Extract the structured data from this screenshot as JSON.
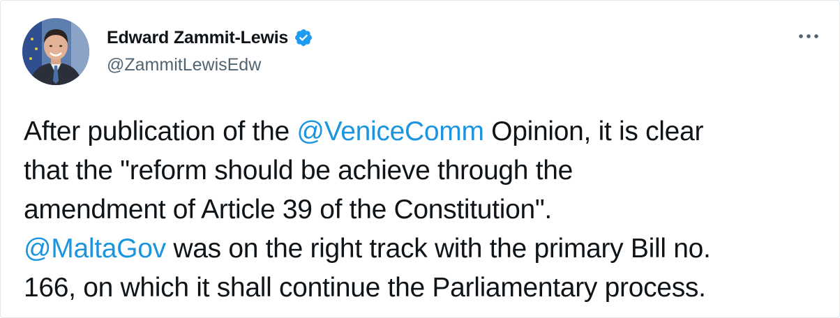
{
  "author": {
    "display_name": "Edward Zammit-Lewis",
    "handle": "@ZammitLewisEdw",
    "verified": true,
    "avatar_icon": "profile-photo",
    "verified_icon": "verified-badge-icon"
  },
  "menu": {
    "icon": "more-options-icon"
  },
  "tweet": {
    "lines": [
      [
        {
          "text": "After publication of the ",
          "type": "text"
        },
        {
          "text": "@VeniceComm",
          "type": "mention"
        },
        {
          "text": " Opinion, it is clear",
          "type": "text"
        }
      ],
      [
        {
          "text": "that the \"reform should be achieve through the",
          "type": "text"
        }
      ],
      [
        {
          "text": "amendment of Article 39 of the Constitution\".",
          "type": "text"
        }
      ],
      [
        {
          "text": "@MaltaGov",
          "type": "mention"
        },
        {
          "text": " was on the right track with the primary Bill no.",
          "type": "text"
        }
      ],
      [
        {
          "text": "166, on which it shall continue the Parliamentary process.",
          "type": "text"
        }
      ]
    ]
  },
  "colors": {
    "text": "#0f1419",
    "secondary_text": "#536471",
    "mention": "#1b95e0",
    "verified": "#1d9bf0",
    "border": "#e1e8ed"
  }
}
